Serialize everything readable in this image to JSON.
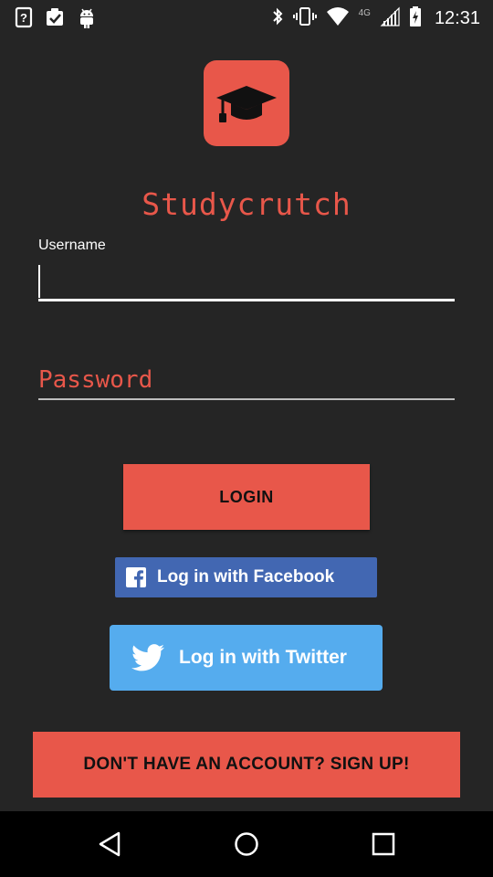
{
  "status_bar": {
    "time": "12:31",
    "network": "4G",
    "left_icons": [
      "help-icon",
      "clipboard-check-icon",
      "android-icon"
    ],
    "right_icons": [
      "bluetooth-icon",
      "vibrate-icon",
      "wifi-icon",
      "signal-icon",
      "battery-charging-icon"
    ]
  },
  "app": {
    "title": "Studycrutch",
    "logo_icon": "graduation-cap-icon"
  },
  "form": {
    "username_label": "Username",
    "username_value": "",
    "password_placeholder": "Password",
    "password_value": ""
  },
  "buttons": {
    "login": "LOGIN",
    "facebook": "Log in with Facebook",
    "twitter": "Log in with Twitter",
    "signup": "DON'T HAVE AN ACCOUNT? SIGN UP!"
  },
  "nav": {
    "icons": [
      "back-icon",
      "home-icon",
      "recents-icon"
    ]
  },
  "colors": {
    "background": "#252525",
    "accent": "#e8574a",
    "facebook": "#4267b2",
    "twitter": "#55acee"
  }
}
